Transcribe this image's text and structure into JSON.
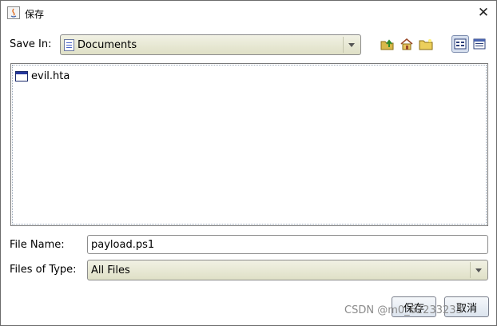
{
  "window": {
    "title": "保存"
  },
  "save_in": {
    "label": "Save In:",
    "value": "Documents",
    "folder_icon": "document-folder-icon"
  },
  "toolbar": {
    "up_icon": "up-one-level-icon",
    "home_icon": "home-icon",
    "new_folder_icon": "new-folder-icon",
    "list_view_icon": "list-view-icon",
    "details_view_icon": "details-view-icon"
  },
  "files": [
    {
      "name": "evil.hta",
      "icon": "hta-file-icon"
    }
  ],
  "file_name": {
    "label": "File Name:",
    "value": "payload.ps1"
  },
  "file_type": {
    "label": "Files of Type:",
    "value": "All Files"
  },
  "buttons": {
    "save": "保存",
    "cancel": "取消"
  },
  "watermark": "CSDN @m0_62233233",
  "colors": {
    "combo_bg": "#e8e9d4",
    "selected_view": "#d6dfee"
  }
}
